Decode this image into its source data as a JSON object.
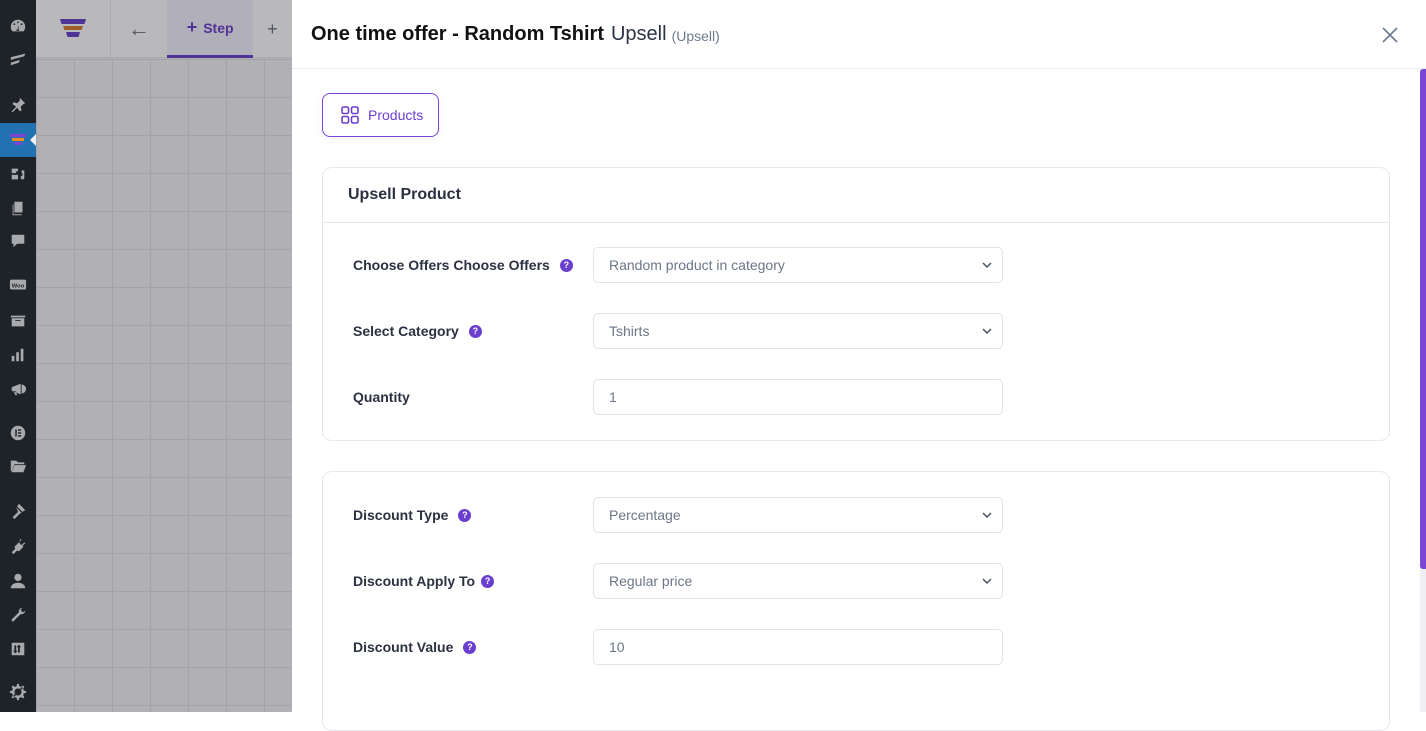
{
  "wp_sidebar": {
    "items": [
      {
        "icon": "dashboard-icon"
      },
      {
        "icon": "elementor-icon"
      },
      {
        "icon": "pin-icon"
      },
      {
        "icon": "funnel-icon",
        "active": true
      },
      {
        "icon": "media-icon"
      },
      {
        "icon": "pages-icon"
      },
      {
        "icon": "comments-icon"
      },
      {
        "icon": "woocommerce-icon",
        "text": "Woo"
      },
      {
        "icon": "archive-icon"
      },
      {
        "icon": "analytics-icon"
      },
      {
        "icon": "marketing-icon"
      },
      {
        "icon": "elementor-circle-icon"
      },
      {
        "icon": "folder-icon"
      },
      {
        "icon": "appearance-icon"
      },
      {
        "icon": "plugins-icon"
      },
      {
        "icon": "users-icon"
      },
      {
        "icon": "tools-icon"
      },
      {
        "icon": "settings-icon"
      },
      {
        "icon": "settings-gear-icon"
      }
    ]
  },
  "builder": {
    "back_icon": "arrow-left-icon",
    "step_label": "Step",
    "add_icon": "plus-icon"
  },
  "drawer": {
    "title": "One time offer - Random Tshirt",
    "subtitle": "Upsell",
    "subtitle_tag": "(Upsell)",
    "close_icon": "close-icon",
    "tab_label": "Products",
    "accent": "#6a3fd0"
  },
  "upsell_product": {
    "heading": "Upsell Product",
    "fields": [
      {
        "label": "Choose Offers Choose Offers",
        "type": "select",
        "value": "Random product in category",
        "help": true
      },
      {
        "label": "Select Category",
        "type": "select",
        "value": "Tshirts",
        "help": true
      },
      {
        "label": "Quantity",
        "type": "input",
        "value": "1",
        "help": false
      }
    ]
  },
  "discount": {
    "fields": [
      {
        "label": "Discount Type",
        "type": "select",
        "value": "Percentage",
        "help": true
      },
      {
        "label": "Discount Apply To",
        "type": "select",
        "value": "Regular price",
        "help": true
      },
      {
        "label": "Discount Value",
        "type": "input",
        "value": "10",
        "help": true
      }
    ]
  }
}
